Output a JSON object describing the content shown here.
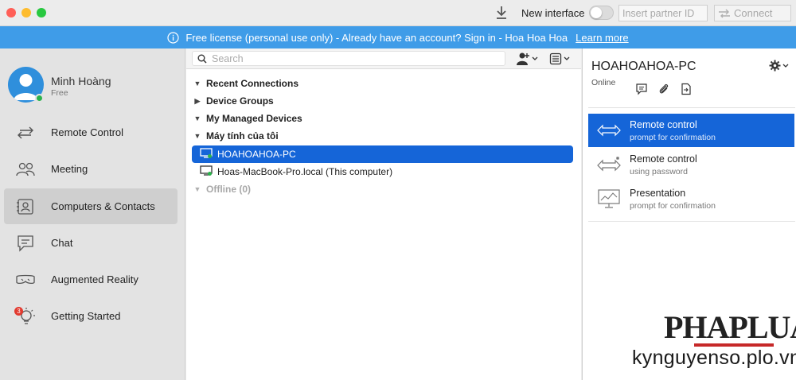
{
  "titlebar": {
    "new_interface_label": "New interface",
    "partner_id_placeholder": "Insert partner ID",
    "connect_label": "Connect"
  },
  "banner": {
    "text": "Free license (personal use only) - Already have an account? Sign in - Hoa Hoa Hoa",
    "link": "Learn more"
  },
  "sidebar": {
    "user_name": "Minh Hoàng",
    "user_plan": "Free",
    "badge_count": "3",
    "items": [
      {
        "label": "Remote Control",
        "icon": "remote-control-icon"
      },
      {
        "label": "Meeting",
        "icon": "meeting-icon"
      },
      {
        "label": "Computers & Contacts",
        "icon": "contacts-icon",
        "active": true
      },
      {
        "label": "Chat",
        "icon": "chat-icon"
      },
      {
        "label": "Augmented Reality",
        "icon": "ar-goggles-icon"
      },
      {
        "label": "Getting Started",
        "icon": "lightbulb-icon"
      }
    ]
  },
  "middle": {
    "search_placeholder": "Search",
    "tree": [
      {
        "label": "Recent Connections"
      },
      {
        "label": "Device Groups"
      },
      {
        "label": "My Managed Devices"
      },
      {
        "label": "Máy tính của tôi"
      },
      {
        "label": "HOAHOAHOA-PC"
      },
      {
        "label": "Hoas-MacBook-Pro.local (This computer)"
      },
      {
        "label": "Offline (0)"
      }
    ]
  },
  "right": {
    "device_name": "HOAHOAHOA-PC",
    "status": "Online",
    "options": [
      {
        "title": "Remote control",
        "subtitle": "prompt for confirmation"
      },
      {
        "title": "Remote control",
        "subtitle": "using password"
      },
      {
        "title": "Presentation",
        "subtitle": "prompt for confirmation"
      }
    ]
  },
  "watermark": {
    "logo": "PHAPLUAT",
    "site": "kynguyenso.plo.vn"
  },
  "colors": {
    "banner": "#3f9ce8",
    "selection": "#1565d8",
    "online": "#2bb24c"
  }
}
